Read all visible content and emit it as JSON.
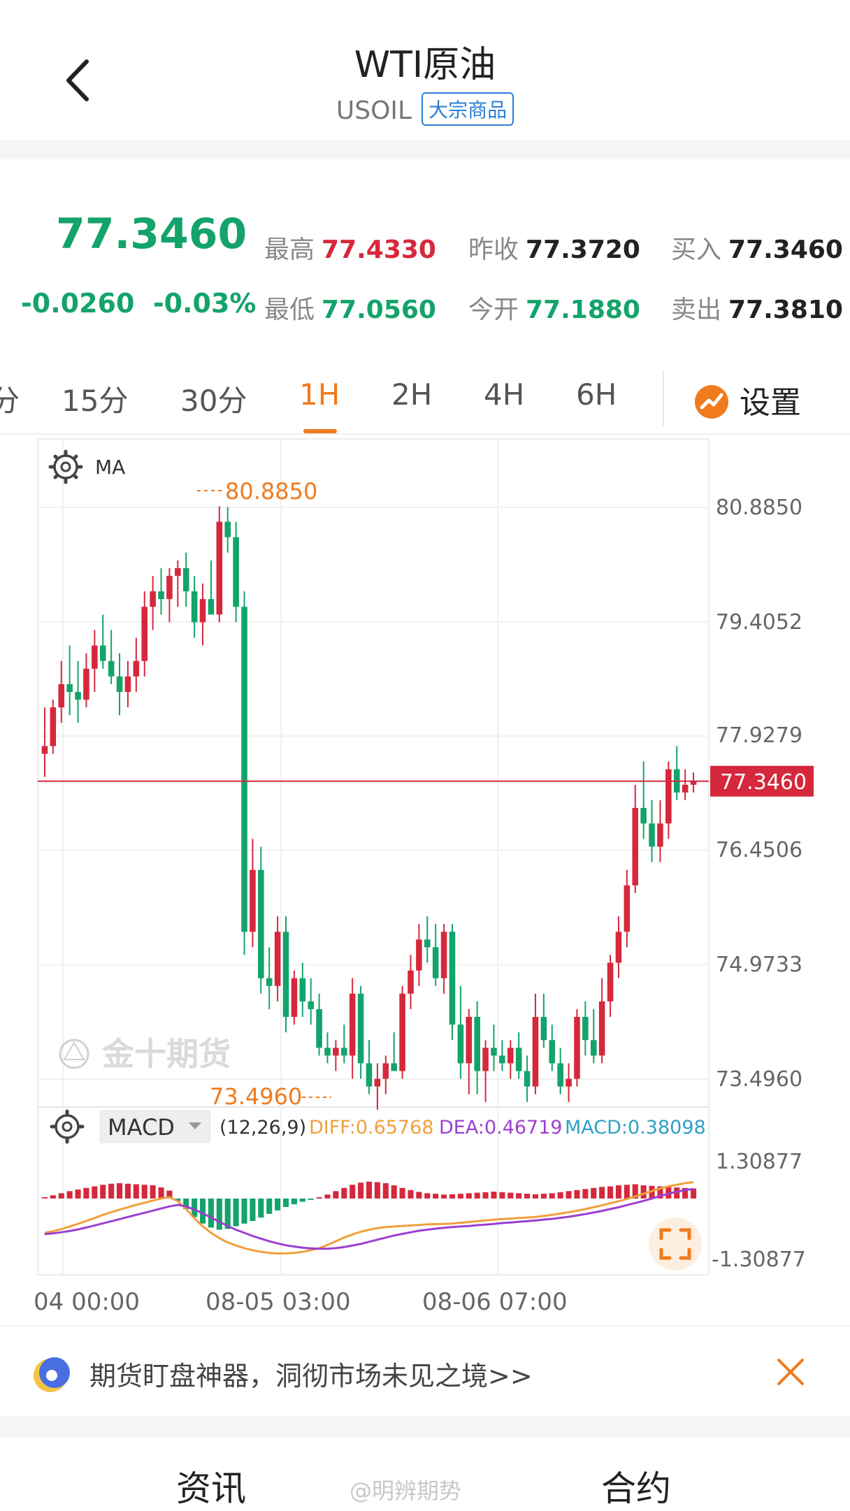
{
  "header": {
    "title": "WTI原油",
    "symbol": "USOIL",
    "badge": "大宗商品"
  },
  "quote": {
    "price": "77.3460",
    "change": "-0.0260",
    "change_pct": "-0.03%",
    "high_label": "最高",
    "high": "77.4330",
    "low_label": "最低",
    "low": "77.0560",
    "prev_close_label": "昨收",
    "prev_close": "77.3720",
    "open_label": "今开",
    "open": "77.1880",
    "bid_label": "买入",
    "bid": "77.3460",
    "ask_label": "卖出",
    "ask": "77.3810"
  },
  "tabs": [
    {
      "label": "分"
    },
    {
      "label": "15分"
    },
    {
      "label": "30分"
    },
    {
      "label": "1H",
      "active": true
    },
    {
      "label": "2H"
    },
    {
      "label": "4H"
    },
    {
      "label": "6H"
    }
  ],
  "settings_label": "设置",
  "chart": {
    "ma_label": "MA",
    "watermark": "金十期货",
    "y_ticks": [
      "80.8850",
      "79.4052",
      "77.9279",
      "76.4506",
      "74.9733",
      "73.4960"
    ],
    "max_label": "80.8850",
    "min_label": "73.4960",
    "current_price": "77.3460",
    "macd_label": "MACD",
    "macd_params": "(12,26,9)",
    "diff": "DIFF:0.65768",
    "dea": "DEA:0.46719",
    "macd": "MACD:0.38098",
    "macd_y_ticks": [
      "1.30877",
      "-1.30877"
    ],
    "x_ticks": [
      "04 00:00",
      "08-05 03:00",
      "08-06 07:00"
    ],
    "colors": {
      "up": "#d6283c",
      "down": "#13a36b",
      "diff": "#f0a03c",
      "dea": "#9b3fd0",
      "macd": "#2ea0c8",
      "accent": "#f07a1c"
    }
  },
  "chart_data": {
    "type": "candlestick",
    "ylim": [
      73.496,
      80.885
    ],
    "candles": [
      [
        77.7,
        78.3,
        77.4,
        77.8
      ],
      [
        77.8,
        78.4,
        77.7,
        78.3
      ],
      [
        78.3,
        78.9,
        78.1,
        78.6
      ],
      [
        78.6,
        79.1,
        78.2,
        78.5
      ],
      [
        78.5,
        78.9,
        78.1,
        78.4
      ],
      [
        78.4,
        79.0,
        78.3,
        78.8
      ],
      [
        78.8,
        79.3,
        78.5,
        79.1
      ],
      [
        79.1,
        79.5,
        78.8,
        78.9
      ],
      [
        78.9,
        79.3,
        78.6,
        78.7
      ],
      [
        78.7,
        79.0,
        78.2,
        78.5
      ],
      [
        78.5,
        78.9,
        78.3,
        78.7
      ],
      [
        78.7,
        79.2,
        78.5,
        78.9
      ],
      [
        78.9,
        79.8,
        78.7,
        79.6
      ],
      [
        79.6,
        80.0,
        79.3,
        79.8
      ],
      [
        79.8,
        80.1,
        79.5,
        79.7
      ],
      [
        79.7,
        80.1,
        79.4,
        80.0
      ],
      [
        80.0,
        80.2,
        79.6,
        80.1
      ],
      [
        80.1,
        80.3,
        79.6,
        79.8
      ],
      [
        79.8,
        80.0,
        79.2,
        79.4
      ],
      [
        79.4,
        79.9,
        79.1,
        79.7
      ],
      [
        79.7,
        80.2,
        79.5,
        79.5
      ],
      [
        79.5,
        80.9,
        79.4,
        80.7
      ],
      [
        80.7,
        80.89,
        80.3,
        80.5
      ],
      [
        80.5,
        80.7,
        79.4,
        79.6
      ],
      [
        79.6,
        79.8,
        75.1,
        75.4
      ],
      [
        75.4,
        76.6,
        75.2,
        76.2
      ],
      [
        76.2,
        76.5,
        74.6,
        74.8
      ],
      [
        74.8,
        75.2,
        74.4,
        74.7
      ],
      [
        74.7,
        75.6,
        74.5,
        75.4
      ],
      [
        75.4,
        75.6,
        74.1,
        74.3
      ],
      [
        74.3,
        74.9,
        74.2,
        74.8
      ],
      [
        74.8,
        75.0,
        74.3,
        74.5
      ],
      [
        74.5,
        74.8,
        74.2,
        74.4
      ],
      [
        74.4,
        74.6,
        73.8,
        73.9
      ],
      [
        73.9,
        74.1,
        73.7,
        73.8
      ],
      [
        73.8,
        74.0,
        73.6,
        73.9
      ],
      [
        73.9,
        74.2,
        73.7,
        73.8
      ],
      [
        73.8,
        74.8,
        73.5,
        74.6
      ],
      [
        74.6,
        74.7,
        73.5,
        73.7
      ],
      [
        73.7,
        74.0,
        73.3,
        73.4
      ],
      [
        73.4,
        73.7,
        73.1,
        73.5
      ],
      [
        73.5,
        73.8,
        73.3,
        73.7
      ],
      [
        73.7,
        74.1,
        73.6,
        73.6
      ],
      [
        73.6,
        74.7,
        73.5,
        74.6
      ],
      [
        74.6,
        75.1,
        74.4,
        74.9
      ],
      [
        74.9,
        75.5,
        74.7,
        75.3
      ],
      [
        75.3,
        75.6,
        75.0,
        75.2
      ],
      [
        75.2,
        75.5,
        74.7,
        74.8
      ],
      [
        74.8,
        75.5,
        74.6,
        75.4
      ],
      [
        75.4,
        75.5,
        74.0,
        74.2
      ],
      [
        74.2,
        74.7,
        73.5,
        73.7
      ],
      [
        73.7,
        74.4,
        73.3,
        74.3
      ],
      [
        74.3,
        74.5,
        73.3,
        73.6
      ],
      [
        73.6,
        74.0,
        73.2,
        73.9
      ],
      [
        73.9,
        74.2,
        73.6,
        73.8
      ],
      [
        73.8,
        74.0,
        73.6,
        73.7
      ],
      [
        73.7,
        74.0,
        73.5,
        73.9
      ],
      [
        73.9,
        74.1,
        73.5,
        73.6
      ],
      [
        73.6,
        73.8,
        73.2,
        73.4
      ],
      [
        73.4,
        74.6,
        73.3,
        74.3
      ],
      [
        74.3,
        74.6,
        73.9,
        74.0
      ],
      [
        74.0,
        74.2,
        73.6,
        73.7
      ],
      [
        73.7,
        73.9,
        73.3,
        73.4
      ],
      [
        73.4,
        73.7,
        73.2,
        73.5
      ],
      [
        73.5,
        74.4,
        73.4,
        74.3
      ],
      [
        74.3,
        74.5,
        73.8,
        74.0
      ],
      [
        74.0,
        74.4,
        73.7,
        73.8
      ],
      [
        73.8,
        74.8,
        73.7,
        74.5
      ],
      [
        74.5,
        75.1,
        74.3,
        75.0
      ],
      [
        75.0,
        75.6,
        74.8,
        75.4
      ],
      [
        75.4,
        76.2,
        75.2,
        76.0
      ],
      [
        76.0,
        77.3,
        75.9,
        77.0
      ],
      [
        77.0,
        77.6,
        76.6,
        76.8
      ],
      [
        76.8,
        77.1,
        76.3,
        76.5
      ],
      [
        76.5,
        77.1,
        76.3,
        76.8
      ],
      [
        76.8,
        77.6,
        76.6,
        77.5
      ],
      [
        77.5,
        77.8,
        77.1,
        77.2
      ],
      [
        77.2,
        77.5,
        77.1,
        77.3
      ],
      [
        77.3,
        77.46,
        77.2,
        77.35
      ]
    ],
    "macd_hist": [
      0.05,
      0.12,
      0.2,
      0.28,
      0.34,
      0.4,
      0.46,
      0.52,
      0.56,
      0.58,
      0.56,
      0.54,
      0.52,
      0.5,
      0.42,
      0.3,
      -0.1,
      -0.4,
      -0.7,
      -0.95,
      -1.1,
      -1.18,
      -1.15,
      -1.05,
      -0.95,
      -0.85,
      -0.72,
      -0.58,
      -0.45,
      -0.32,
      -0.22,
      -0.12,
      -0.05,
      0.05,
      0.15,
      0.28,
      0.4,
      0.52,
      0.6,
      0.64,
      0.62,
      0.58,
      0.5,
      0.4,
      0.32,
      0.25,
      0.2,
      0.18,
      0.15,
      0.16,
      0.18,
      0.2,
      0.22,
      0.24,
      0.26,
      0.24,
      0.22,
      0.2,
      0.18,
      0.16,
      0.18,
      0.2,
      0.24,
      0.28,
      0.32,
      0.36,
      0.4,
      0.44,
      0.46,
      0.5,
      0.52,
      0.54,
      0.5,
      0.48,
      0.46,
      0.44,
      0.42,
      0.4,
      0.38
    ],
    "diff_line": [
      -1.3,
      -1.24,
      -1.16,
      -1.06,
      -0.96,
      -0.85,
      -0.74,
      -0.62,
      -0.52,
      -0.42,
      -0.33,
      -0.24,
      -0.16,
      -0.08,
      0.0,
      0.05,
      -0.1,
      -0.4,
      -0.75,
      -1.05,
      -1.3,
      -1.5,
      -1.66,
      -1.78,
      -1.88,
      -1.96,
      -2.02,
      -2.06,
      -2.08,
      -2.08,
      -2.06,
      -2.02,
      -1.96,
      -1.88,
      -1.76,
      -1.62,
      -1.48,
      -1.36,
      -1.26,
      -1.18,
      -1.12,
      -1.08,
      -1.06,
      -1.04,
      -1.02,
      -1.0,
      -0.98,
      -0.97,
      -0.96,
      -0.95,
      -0.92,
      -0.89,
      -0.86,
      -0.83,
      -0.8,
      -0.78,
      -0.76,
      -0.74,
      -0.72,
      -0.7,
      -0.66,
      -0.62,
      -0.57,
      -0.52,
      -0.46,
      -0.4,
      -0.33,
      -0.26,
      -0.18,
      -0.1,
      -0.02,
      0.08,
      0.18,
      0.28,
      0.38,
      0.46,
      0.52,
      0.58,
      0.62
    ],
    "dea_line": [
      -1.35,
      -1.32,
      -1.28,
      -1.23,
      -1.17,
      -1.1,
      -1.02,
      -0.94,
      -0.86,
      -0.78,
      -0.7,
      -0.62,
      -0.54,
      -0.46,
      -0.38,
      -0.3,
      -0.24,
      -0.3,
      -0.42,
      -0.56,
      -0.72,
      -0.88,
      -1.04,
      -1.18,
      -1.3,
      -1.42,
      -1.52,
      -1.62,
      -1.7,
      -1.77,
      -1.82,
      -1.86,
      -1.89,
      -1.9,
      -1.9,
      -1.88,
      -1.84,
      -1.78,
      -1.72,
      -1.64,
      -1.56,
      -1.48,
      -1.4,
      -1.34,
      -1.28,
      -1.22,
      -1.18,
      -1.14,
      -1.11,
      -1.08,
      -1.06,
      -1.04,
      -1.01,
      -0.99,
      -0.96,
      -0.93,
      -0.91,
      -0.88,
      -0.86,
      -0.83,
      -0.8,
      -0.77,
      -0.73,
      -0.69,
      -0.64,
      -0.59,
      -0.53,
      -0.47,
      -0.4,
      -0.33,
      -0.25,
      -0.17,
      -0.09,
      0.0,
      0.1,
      0.18,
      0.26,
      0.32,
      0.36
    ],
    "macd_ylim": [
      -2.2,
      1.4
    ]
  },
  "banner": {
    "text": "期货盯盘神器，洞彻市场未见之境>>"
  },
  "bottom_tabs": [
    "资讯",
    "合约"
  ],
  "footer_watermark": "@明辨期势"
}
